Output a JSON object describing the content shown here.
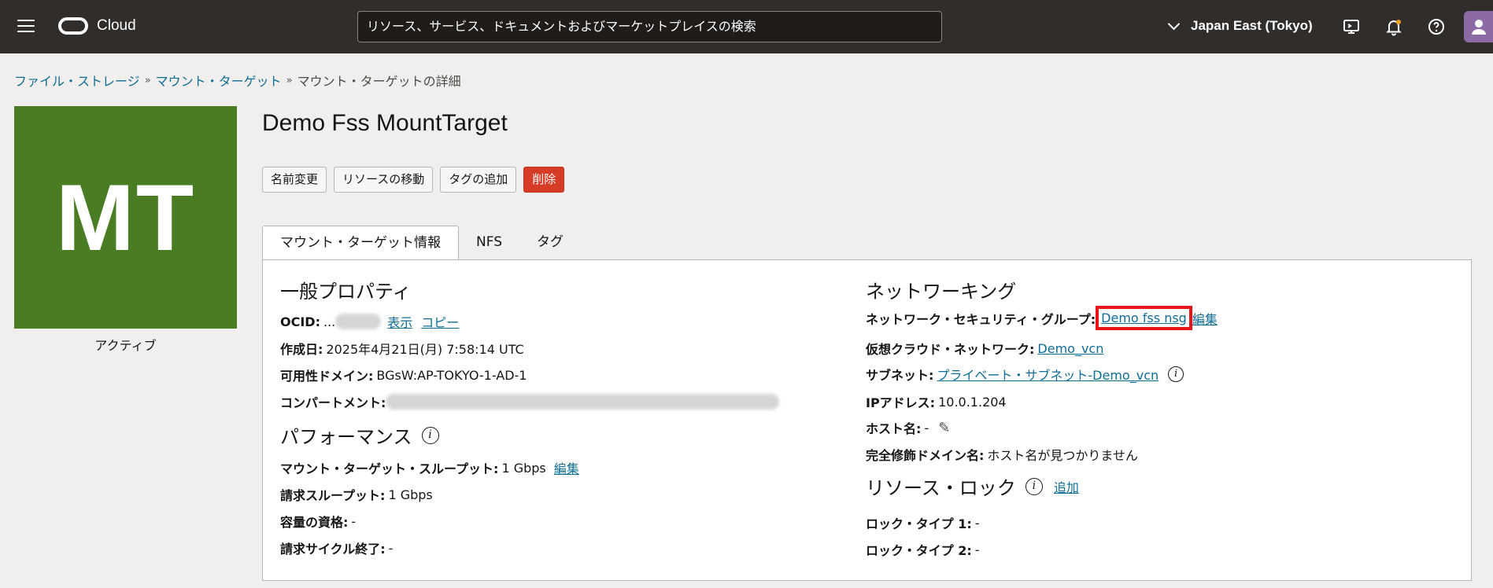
{
  "header": {
    "brand": "Cloud",
    "search_placeholder": "リソース、サービス、ドキュメントおよびマーケットプレイスの検索",
    "region": "Japan East (Tokyo)"
  },
  "breadcrumb": {
    "items": [
      "ファイル・ストレージ",
      "マウント・ターゲット"
    ],
    "current": "マウント・ターゲットの詳細"
  },
  "badge": {
    "initials": "MT",
    "status": "アクティブ",
    "color": "#4a7d23"
  },
  "page": {
    "title": "Demo Fss MountTarget"
  },
  "actions": [
    "名前変更",
    "リソースの移動",
    "タグの追加",
    "削除"
  ],
  "tabs": [
    "マウント・ターゲット情報",
    "NFS",
    "タグ"
  ],
  "general": {
    "heading": "一般プロパティ",
    "ocid_label": "OCID:",
    "ocid_prefix": "...",
    "show_link": "表示",
    "copy_link": "コピー",
    "created_label": "作成日:",
    "created_value": "2025年4月21日(月) 7:58:14 UTC",
    "ad_label": "可用性ドメイン:",
    "ad_value": "BGsW:AP-TOKYO-1-AD-1",
    "compartment_label": "コンパートメント:"
  },
  "performance": {
    "heading": "パフォーマンス",
    "throughput_label": "マウント・ターゲット・スループット:",
    "throughput_value": "1 Gbps",
    "edit_link": "編集",
    "billing_label": "請求スループット:",
    "billing_value": "1 Gbps",
    "capacity_label": "容量の資格:",
    "capacity_value": "-",
    "cycle_label": "請求サイクル終了:",
    "cycle_value": "-"
  },
  "networking": {
    "heading": "ネットワーキング",
    "nsg_label": "ネットワーク・セキュリティ・グループ:",
    "nsg_value": "Demo fss nsg",
    "nsg_edit": "編集",
    "vcn_label": "仮想クラウド・ネットワーク:",
    "vcn_value": "Demo_vcn",
    "subnet_label": "サブネット:",
    "subnet_value": "プライベート・サブネット-Demo_vcn",
    "ip_label": "IPアドレス:",
    "ip_value": "10.0.1.204",
    "host_label": "ホスト名:",
    "host_value": "-",
    "fqdn_label": "完全修飾ドメイン名:",
    "fqdn_value": "ホスト名が見つかりません"
  },
  "locks": {
    "heading": "リソース・ロック",
    "add_link": "追加",
    "lock1_label": "ロック・タイプ 1:",
    "lock1_value": "-",
    "lock2_label": "ロック・タイプ 2:",
    "lock2_value": "-"
  },
  "colors": {
    "topbar": "#312d2a",
    "link": "#0e6d94",
    "danger": "#d63b25",
    "highlight": "#e8141a"
  }
}
